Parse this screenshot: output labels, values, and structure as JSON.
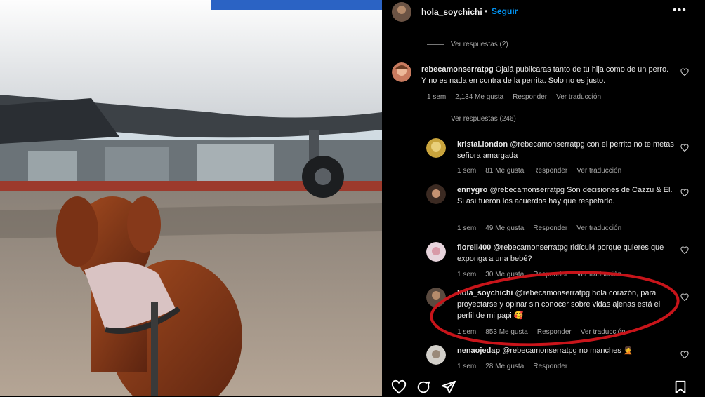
{
  "post": {
    "image_alt": "Perro mirando un avión",
    "username": "hola_soychichi",
    "follow_label": "Seguir",
    "separator": "•",
    "more_icon": "more-dots-icon"
  },
  "comments": [
    {
      "id": "c0",
      "show_replies": "Ver respuestas (2)"
    },
    {
      "id": "c1",
      "username": "rebecamonserratpg",
      "text": "Ojalá publicaras tanto de tu hija como de un perro. Y no es nada en contra de la perrita. Solo no es justo.",
      "time": "1 sem",
      "likes": "2,134 Me gusta",
      "reply": "Responder",
      "translate": "Ver traducción",
      "replies_toggle": "Ver respuestas (246)"
    },
    {
      "id": "r1",
      "username": "kristal.london",
      "text": "@rebecamonserratpg con el perrito no te metas señora amargada",
      "time": "1 sem",
      "likes": "81 Me gusta",
      "reply": "Responder",
      "translate": "Ver traducción"
    },
    {
      "id": "r2",
      "username": "ennygro",
      "text": "@rebecamonserratpg Son decisiones de Cazzu & El. Si así fueron los acuerdos hay que respetarlo.",
      "time": "1 sem",
      "likes": "49 Me gusta",
      "reply": "Responder",
      "translate": "Ver traducción"
    },
    {
      "id": "r3",
      "username": "fiorell400",
      "text": "@rebecamonserratpg ridícul4 porque quieres que exponga a una bebé?",
      "time": "1 sem",
      "likes": "30 Me gusta",
      "reply": "Responder",
      "translate": "Ver traducción"
    },
    {
      "id": "r4",
      "username": "hola_soychichi",
      "text": "@rebecamonserratpg hola corazón, para proyectarse y opinar sin conocer sobre vidas ajenas está el perfil de mi papi 🥰",
      "time": "1 sem",
      "likes": "853 Me gusta",
      "reply": "Responder",
      "translate": "Ver traducción"
    },
    {
      "id": "r5",
      "username": "nenaojedap",
      "text": "@rebecamonserratpg no manches 🤦",
      "time": "1 sem",
      "likes": "28 Me gusta",
      "reply": "Responder"
    }
  ],
  "footer": {
    "icons": [
      "heart-icon",
      "comment-icon",
      "share-icon",
      "bookmark-icon"
    ]
  },
  "colors": {
    "link_blue": "#0095f6",
    "highlight_red": "#c8141a",
    "muted": "#a8a8a8"
  }
}
